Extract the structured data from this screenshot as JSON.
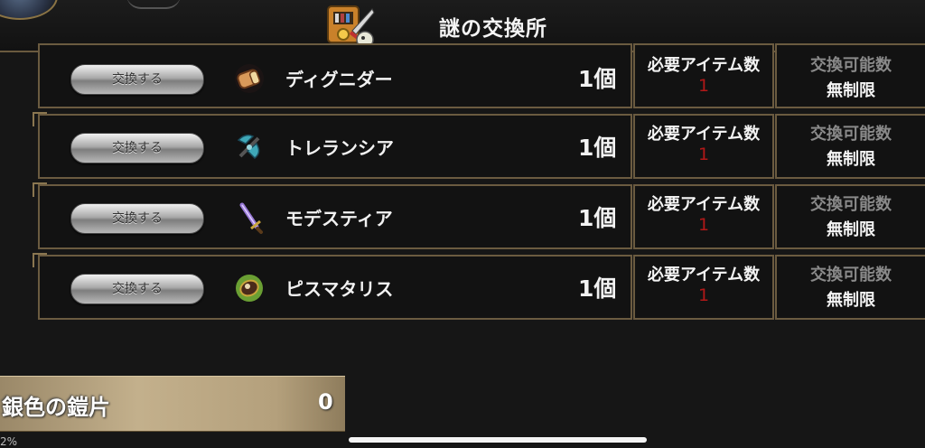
{
  "header": {
    "title": "謎の交換所"
  },
  "rows": [
    {
      "button_label": "交換する",
      "item_name": "ディグニダー",
      "quantity": "1個",
      "required_label": "必要アイテム数",
      "required_value": "1",
      "available_label": "交換可能数",
      "available_value": "無制限",
      "icon": "scroll-icon",
      "icon_color": "#d99a5a"
    },
    {
      "button_label": "交換する",
      "item_name": "トレランシア",
      "quantity": "1個",
      "required_label": "必要アイテム数",
      "required_value": "1",
      "available_label": "交換可能数",
      "available_value": "無制限",
      "icon": "axe-icon",
      "icon_color": "#3fa8b8"
    },
    {
      "button_label": "交換する",
      "item_name": "モデスティア",
      "quantity": "1個",
      "required_label": "必要アイテム数",
      "required_value": "1",
      "available_label": "交換可能数",
      "available_value": "無制限",
      "icon": "sword-icon",
      "icon_color": "#9a7ad8"
    },
    {
      "button_label": "交換する",
      "item_name": "ピスマタリス",
      "quantity": "1個",
      "required_label": "必要アイテム数",
      "required_value": "1",
      "available_label": "交換可能数",
      "available_value": "無制限",
      "icon": "shield-icon",
      "icon_color": "#7ab83a"
    }
  ],
  "material": {
    "name": "銀色の鎧片",
    "count": "0"
  },
  "corner_text": "2%",
  "colors": {
    "frame": "#6b5b40",
    "required_value": "#b01818",
    "available_label": "#8a8a8a"
  }
}
